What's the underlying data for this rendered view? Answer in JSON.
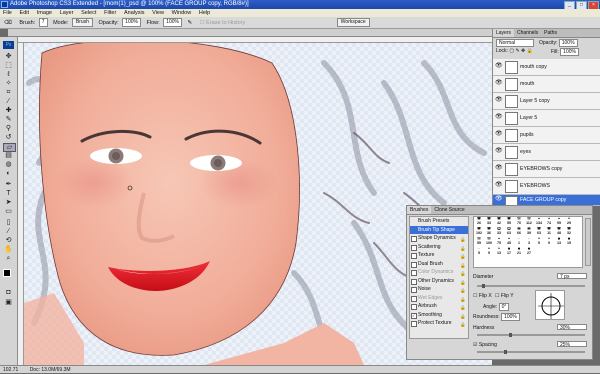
{
  "window": {
    "title": "Adobe Photoshop CS3 Extended - [mom(1)_psd @ 100% (FACE GROUP copy, RGB/8#)]",
    "controls": [
      "_",
      "□",
      "×"
    ]
  },
  "menu": [
    "File",
    "Edit",
    "Image",
    "Layer",
    "Select",
    "Filter",
    "Analysis",
    "View",
    "Window",
    "Help"
  ],
  "options_bar": {
    "brush_label": "Brush:",
    "brush_size": "7",
    "mode_label": "Mode:",
    "mode_value": "Brush",
    "opacity_label": "Opacity:",
    "opacity_value": "100%",
    "flow_label": "Flow:",
    "flow_value": "100%",
    "erase_history": "Erase to History",
    "workspace": "Workspace"
  },
  "status": {
    "zoom": "102.71",
    "doc": "Doc: 13.0M/69.3M"
  },
  "layers_panel": {
    "tabs": [
      "Layers",
      "Channels",
      "Paths"
    ],
    "blend_mode": "Normal",
    "opacity_label": "Opacity:",
    "opacity_value": "100%",
    "lock_label": "Lock:",
    "fill_label": "Fill:",
    "fill_value": "100%",
    "layers": [
      {
        "name": "mouth copy",
        "selected": false
      },
      {
        "name": "mouth",
        "selected": false
      },
      {
        "name": "Layer 5 copy",
        "selected": false
      },
      {
        "name": "Layer 5",
        "selected": false
      },
      {
        "name": "pupils",
        "selected": false
      },
      {
        "name": "eyes",
        "selected": false
      },
      {
        "name": "EYEBROWS copy",
        "selected": false
      },
      {
        "name": "EYEBROWS",
        "selected": false
      },
      {
        "name": "FACE GROUP copy",
        "selected": true
      }
    ]
  },
  "brushes_panel": {
    "tabs": [
      "Brushes",
      "Clone Source"
    ],
    "list": [
      {
        "label": "Brush Presets",
        "checkbox": false,
        "checked": false,
        "selected": false
      },
      {
        "label": "Brush Tip Shape",
        "checkbox": false,
        "checked": false,
        "selected": true
      },
      {
        "label": "Shape Dynamics",
        "checkbox": true,
        "checked": false,
        "selected": false
      },
      {
        "label": "Scattering",
        "checkbox": true,
        "checked": false,
        "selected": false
      },
      {
        "label": "Texture",
        "checkbox": true,
        "checked": false,
        "selected": false
      },
      {
        "label": "Dual Brush",
        "checkbox": true,
        "checked": false,
        "selected": false
      },
      {
        "label": "Color Dynamics",
        "checkbox": true,
        "checked": false,
        "selected": false
      },
      {
        "label": "Other Dynamics",
        "checkbox": true,
        "checked": false,
        "selected": false
      },
      {
        "label": "Noise",
        "checkbox": true,
        "checked": false,
        "selected": false
      },
      {
        "label": "Wet Edges",
        "checkbox": true,
        "checked": false,
        "selected": false
      },
      {
        "label": "Airbrush",
        "checkbox": true,
        "checked": false,
        "selected": false
      },
      {
        "label": "Smoothing",
        "checkbox": true,
        "checked": true,
        "selected": false
      },
      {
        "label": "Protect Texture",
        "checkbox": true,
        "checked": false,
        "selected": false
      }
    ],
    "tip_sizes": [
      "26",
      "33",
      "42",
      "55",
      "70",
      "112",
      "134",
      "74",
      "95",
      "29",
      "192",
      "36",
      "33",
      "63",
      "66",
      "39",
      "63",
      "11",
      "48",
      "32",
      "55",
      "100",
      "75",
      "45",
      "1",
      "3",
      "5",
      "9",
      "13",
      "19",
      "5",
      "9",
      "13",
      "17",
      "21",
      "27"
    ],
    "diameter_label": "Diameter",
    "diameter_value": "7 px",
    "flip_x": "Flip X",
    "flip_y": "Flip Y",
    "angle_label": "Angle:",
    "angle_value": "0°",
    "roundness_label": "Roundness:",
    "roundness_value": "100%",
    "hardness_label": "Hardness",
    "hardness_value": "30%",
    "spacing_label": "Spacing",
    "spacing_value": "25%",
    "spacing_checked": true,
    "diameter_level": 0.05,
    "hardness_level": 0.3,
    "spacing_level": 0.25
  },
  "colors": {
    "accent": "#3a6fd8",
    "lips": "#e0141e",
    "skin": "#f2b4a3",
    "iris": "#8a7a78"
  }
}
